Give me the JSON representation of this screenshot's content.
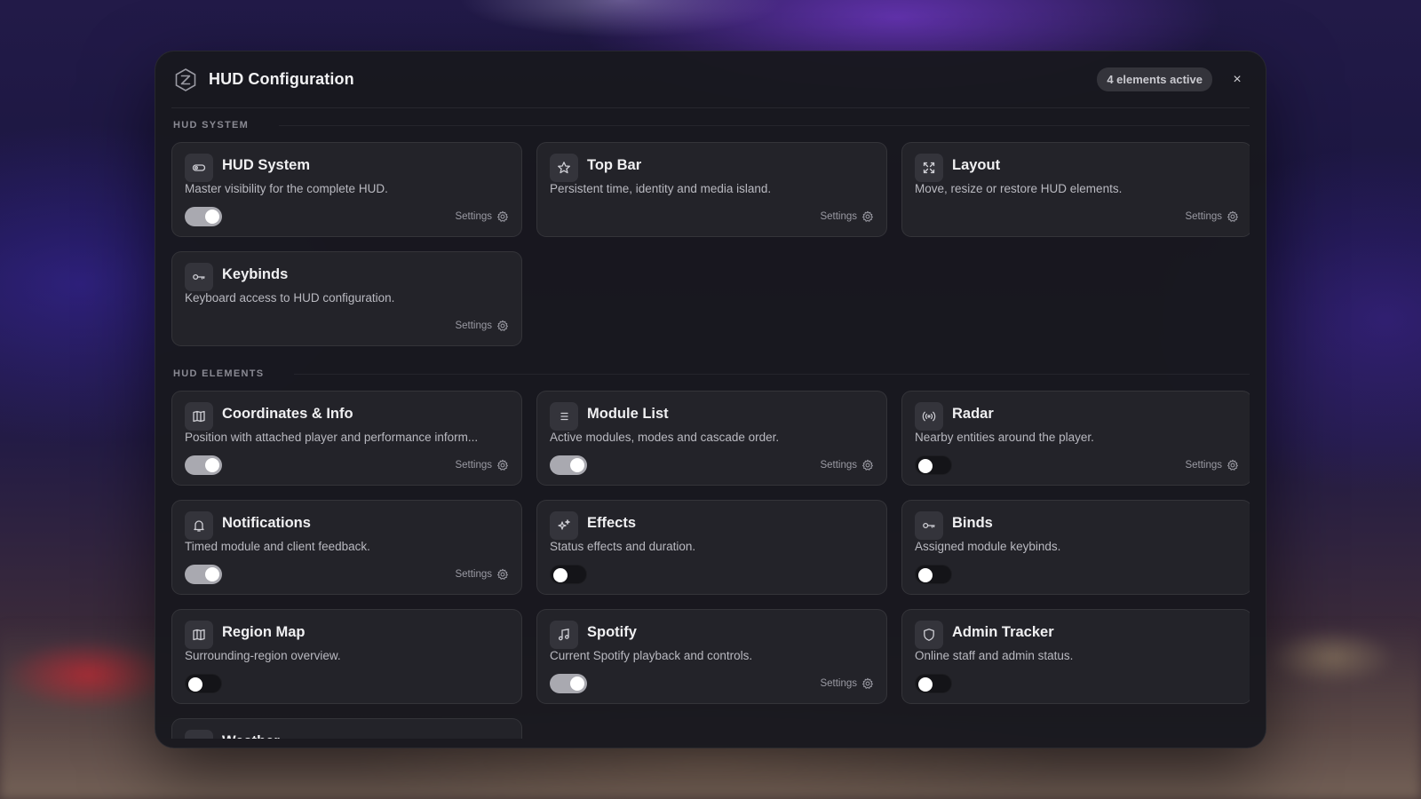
{
  "header": {
    "title": "HUD Configuration",
    "badge": "4 elements active",
    "close_label": "×"
  },
  "sections": [
    {
      "label": "HUD SYSTEM",
      "cards": [
        {
          "title": "HUD System",
          "desc": "Master visibility for the complete HUD.",
          "icon": "toggle-icon",
          "toggle": true,
          "settings": true
        },
        {
          "title": "Top Bar",
          "desc": "Persistent time, identity and media island.",
          "icon": "star-icon",
          "toggle": null,
          "settings": true
        },
        {
          "title": "Layout",
          "desc": "Move, resize or restore HUD elements.",
          "icon": "expand-icon",
          "toggle": null,
          "settings": true
        },
        {
          "title": "Keybinds",
          "desc": "Keyboard access to HUD configuration.",
          "icon": "key-icon",
          "toggle": null,
          "settings": true
        }
      ]
    },
    {
      "label": "HUD ELEMENTS",
      "cards": [
        {
          "title": "Coordinates & Info",
          "desc": "Position with attached player and performance inform...",
          "icon": "map-icon",
          "toggle": true,
          "settings": true
        },
        {
          "title": "Module List",
          "desc": "Active modules, modes and cascade order.",
          "icon": "list-icon",
          "toggle": true,
          "settings": true
        },
        {
          "title": "Radar",
          "desc": "Nearby entities around the player.",
          "icon": "radar-icon",
          "toggle": false,
          "settings": true
        },
        {
          "title": "Notifications",
          "desc": "Timed module and client feedback.",
          "icon": "bell-icon",
          "toggle": true,
          "settings": true
        },
        {
          "title": "Effects",
          "desc": "Status effects and duration.",
          "icon": "sparkle-icon",
          "toggle": false,
          "settings": false
        },
        {
          "title": "Binds",
          "desc": "Assigned module keybinds.",
          "icon": "key-icon",
          "toggle": false,
          "settings": false
        },
        {
          "title": "Region Map",
          "desc": "Surrounding-region overview.",
          "icon": "map-icon",
          "toggle": false,
          "settings": false
        },
        {
          "title": "Spotify",
          "desc": "Current Spotify playback and controls.",
          "icon": "music-icon",
          "toggle": true,
          "settings": true
        },
        {
          "title": "Admin Tracker",
          "desc": "Online staff and admin status.",
          "icon": "shield-icon",
          "toggle": false,
          "settings": false
        },
        {
          "title": "Weather",
          "desc": "",
          "icon": "weather-icon",
          "toggle": null,
          "settings": false,
          "partial": true
        }
      ]
    }
  ],
  "settings_label": "Settings",
  "colors": {
    "panel_bg": "#18181e",
    "card_bg": "#232329",
    "toggle_on": "#a9a9b0",
    "toggle_off": "#141418"
  }
}
